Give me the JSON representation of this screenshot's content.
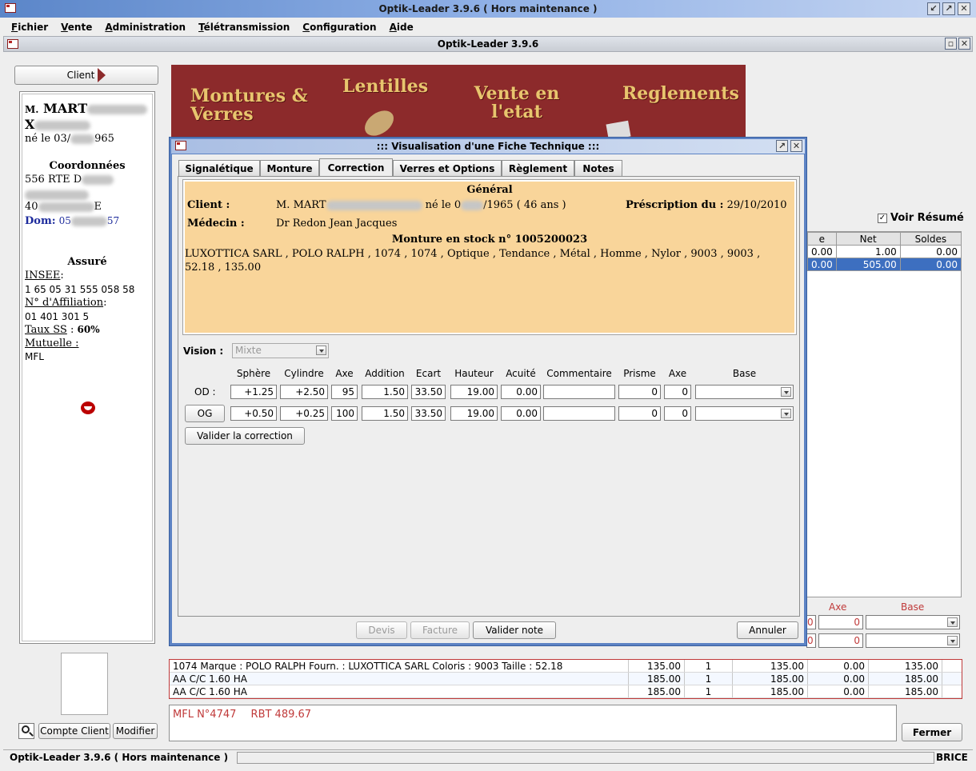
{
  "app": {
    "window_title": "Optik-Leader 3.9.6 ( Hors maintenance )",
    "inner_title": "Optik-Leader 3.9.6",
    "menu": [
      "Fichier",
      "Vente",
      "Administration",
      "Télétransmission",
      "Configuration",
      "Aide"
    ]
  },
  "client_panel": {
    "client_button": "Client",
    "prefix": "M.",
    "name": "MART",
    "name_line2": "X",
    "birth_prefix": "né le 03/",
    "birth_suffix": "965",
    "coord_title": "Coordonnées",
    "address1": "556 RTE D",
    "address3_prefix": "40",
    "address3_suffix": "E",
    "dom_label": "Dom:",
    "dom_prefix": "05",
    "dom_suffix": "57",
    "assure_title": "Assuré",
    "insee_label": "INSEE",
    "insee_value": "1 65 05 31 555 058 58",
    "affiliation_label": "N° d'Affiliation",
    "affiliation_value": "01 401 301 5",
    "taux_label": "Taux SS",
    "taux_value": "60%",
    "mutuelle_label": "Mutuelle :",
    "mutuelle_value": "MFL",
    "compte_button": "Compte Client",
    "modifier_button": "Modifier"
  },
  "banner": {
    "montures": "Montures & Verres",
    "lentilles": "Lentilles",
    "vente": "Vente en l'etat",
    "reglements": "Reglements"
  },
  "right_panel": {
    "voir_resume": "Voir Résumé",
    "headers": [
      "e",
      "Net",
      "Soldes"
    ],
    "rows": [
      [
        "0.00",
        "1.00",
        "0.00"
      ],
      [
        "0.00",
        "505.00",
        "0.00"
      ]
    ],
    "axe_label": "Axe",
    "base_label": "Base",
    "axe_values": [
      "0",
      "0"
    ]
  },
  "dialog": {
    "title": "::: Visualisation d'une Fiche Technique :::",
    "tabs": [
      "Signalétique",
      "Monture",
      "Correction",
      "Verres et Options",
      "Règlement",
      "Notes"
    ],
    "general_title": "Général",
    "client_label": "Client :",
    "client_name": "M. MART",
    "client_birth_prefix": "né le 0",
    "client_birth_suffix": "/1965 ( 46 ans )",
    "prescription_label": "Préscription du :",
    "prescription_date": "29/10/2010",
    "medecin_label": "Médecin :",
    "medecin_value": "Dr Redon Jean Jacques",
    "monture_title": "Monture en stock n° 1005200023",
    "monture_desc": "LUXOTTICA SARL , POLO RALPH , 1074 , 1074 , Optique , Tendance , Métal , Homme , Nylor , 9003 , 9003 , 52.18 , 135.00",
    "vision_label": "Vision :",
    "vision_value": "Mixte",
    "columns": [
      "Sphère",
      "Cylindre",
      "Axe",
      "Addition",
      "Ecart",
      "Hauteur",
      "Acuité",
      "Commentaire",
      "Prisme",
      "Axe",
      "Base"
    ],
    "od": {
      "label": "OD :",
      "values": [
        "+1.25",
        "+2.50",
        "95",
        "1.50",
        "33.50",
        "19.00",
        "0.00",
        "",
        "0",
        "0",
        ""
      ]
    },
    "og": {
      "label": "OG",
      "values": [
        "+0.50",
        "+0.25",
        "100",
        "1.50",
        "33.50",
        "19.00",
        "0.00",
        "",
        "0",
        "0",
        ""
      ]
    },
    "valider_correction": "Valider la correction",
    "devis": "Devis",
    "facture": "Facture",
    "valider_note": "Valider note",
    "annuler": "Annuler"
  },
  "lines": [
    [
      "1074   Marque : POLO RALPH   Fourn. : LUXOTTICA SARL   Coloris : 9003   Taille : 52.18",
      "135.00",
      "1",
      "135.00",
      "0.00",
      "135.00"
    ],
    [
      "AA C/C 1.60 HA",
      "185.00",
      "1",
      "185.00",
      "0.00",
      "185.00"
    ],
    [
      "AA C/C 1.60 HA",
      "185.00",
      "1",
      "185.00",
      "0.00",
      "185.00"
    ]
  ],
  "notes": {
    "mfl": "MFL N°4747",
    "rbt": "RBT 489.67"
  },
  "fermer": "Fermer",
  "status": {
    "left": "Optik-Leader 3.9.6 ( Hors maintenance )",
    "right": "BRICE"
  },
  "colors": {
    "banner": "#8c2a2b",
    "banner_text": "#e8c56e",
    "dialog_frame": "#5d83c4",
    "yellow_panel": "#f9d59a",
    "selected_row": "#3d6fc0",
    "note_text": "#c03a3a"
  }
}
